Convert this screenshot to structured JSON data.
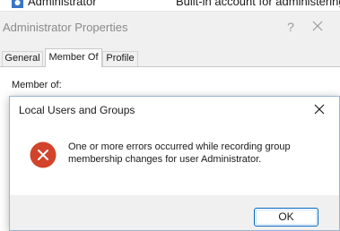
{
  "background_list": {
    "user_name": "Administrator",
    "user_description": "Built-in account for administering..."
  },
  "properties_window": {
    "title": "Administrator Properties",
    "help_glyph": "?",
    "tabs": [
      {
        "label": "General",
        "active": false
      },
      {
        "label": "Member Of",
        "active": true
      },
      {
        "label": "Profile",
        "active": false
      }
    ],
    "member_of_label": "Member of:"
  },
  "dialog": {
    "title": "Local Users and Groups",
    "message": "One or more errors occurred while recording group membership changes for user Administrator.",
    "ok_label": "OK",
    "icon": "error-icon",
    "colors": {
      "error_red": "#d1432a",
      "button_border": "#0067c0"
    }
  }
}
